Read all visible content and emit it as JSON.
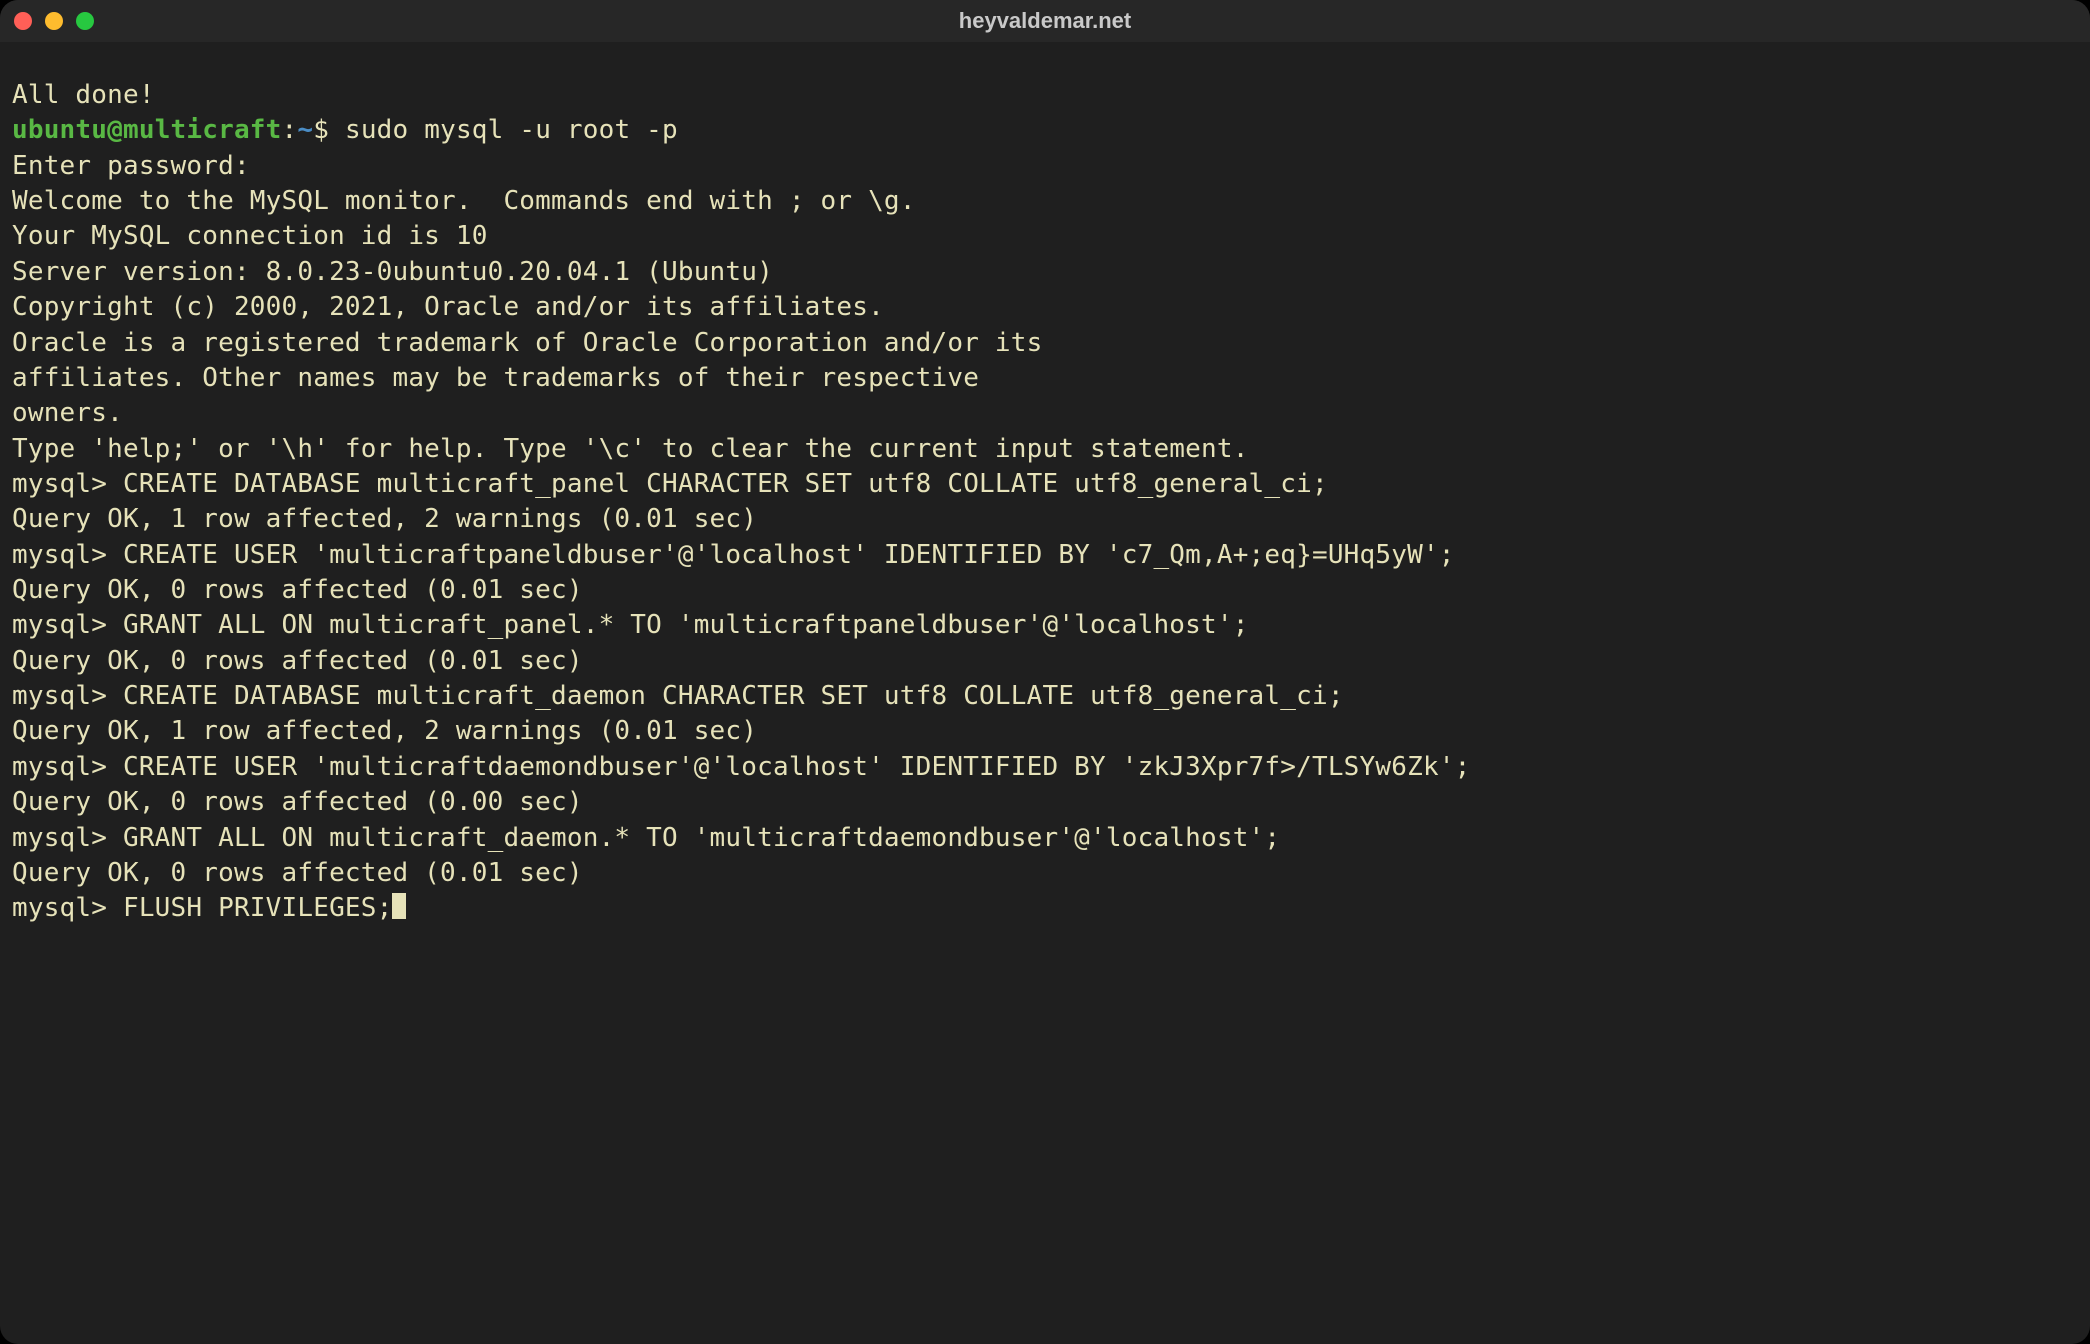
{
  "window": {
    "title": "heyvaldemar.net"
  },
  "prompt": {
    "user": "ubuntu",
    "at": "@",
    "host": "multicraft",
    "colon": ":",
    "path": "~",
    "dollar": "$ "
  },
  "lines": {
    "l0": "All done!",
    "cmd1": "sudo mysql -u root -p",
    "l2": "Enter password:",
    "l3": "Welcome to the MySQL monitor.  Commands end with ; or \\g.",
    "l4": "Your MySQL connection id is 10",
    "l5": "Server version: 8.0.23-0ubuntu0.20.04.1 (Ubuntu)",
    "l6": "",
    "l7": "Copyright (c) 2000, 2021, Oracle and/or its affiliates.",
    "l8": "",
    "l9": "Oracle is a registered trademark of Oracle Corporation and/or its",
    "l10": "affiliates. Other names may be trademarks of their respective",
    "l11": "owners.",
    "l12": "",
    "l13": "Type 'help;' or '\\h' for help. Type '\\c' to clear the current input statement.",
    "l14": "",
    "l15": "mysql> CREATE DATABASE multicraft_panel CHARACTER SET utf8 COLLATE utf8_general_ci;",
    "l16": "Query OK, 1 row affected, 2 warnings (0.01 sec)",
    "l17": "",
    "l18": "mysql> CREATE USER 'multicraftpaneldbuser'@'localhost' IDENTIFIED BY 'c7_Qm,A+;eq}=UHq5yW';",
    "l19": "Query OK, 0 rows affected (0.01 sec)",
    "l20": "",
    "l21": "mysql> GRANT ALL ON multicraft_panel.* TO 'multicraftpaneldbuser'@'localhost';",
    "l22": "Query OK, 0 rows affected (0.01 sec)",
    "l23": "",
    "l24": "mysql> CREATE DATABASE multicraft_daemon CHARACTER SET utf8 COLLATE utf8_general_ci;",
    "l25": "Query OK, 1 row affected, 2 warnings (0.01 sec)",
    "l26": "",
    "l27": "mysql> CREATE USER 'multicraftdaemondbuser'@'localhost' IDENTIFIED BY 'zkJ3Xpr7f>/TLSYw6Zk';",
    "l28": "Query OK, 0 rows affected (0.00 sec)",
    "l29": "",
    "l30": "mysql> GRANT ALL ON multicraft_daemon.* TO 'multicraftdaemondbuser'@'localhost';",
    "l31": "Query OK, 0 rows affected (0.01 sec)",
    "l32": "",
    "l33": "mysql> FLUSH PRIVILEGES;"
  }
}
